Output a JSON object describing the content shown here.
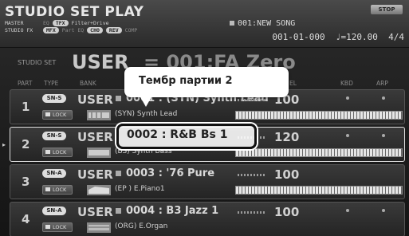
{
  "header": {
    "title": "STUDIO SET PLAY",
    "stop_label": "STOP",
    "row1_label": "MASTER",
    "row1_items": [
      "EQ",
      "TFX",
      "Filter+Drive"
    ],
    "row2_label": "STUDIO FX",
    "row2_items": [
      "MFX",
      "Part EQ",
      "CHO",
      "REV",
      "COMP"
    ],
    "song_label": "001:NEW SONG",
    "position": "001-01-000",
    "tempo": "♩=120.00",
    "time_sig": "4/4"
  },
  "studio_set": {
    "label": "STUDIO SET",
    "bank": "USER",
    "name": "= 001:FA Zero"
  },
  "columns": {
    "part": "PART",
    "type": "TYPE",
    "bank": "BANK",
    "level": "EL",
    "kbd": "KBD",
    "arp": "ARP"
  },
  "parts": [
    {
      "num": "1",
      "type": "SN-S",
      "lock": "LOCK",
      "bank": "USER",
      "tone": "0001 : (SYN) Synth Lead",
      "category": "(SYN) Synth Lead",
      "level": "100",
      "icon": "synth-icon"
    },
    {
      "num": "2",
      "type": "SN-S",
      "lock": "LOCK",
      "bank": "USER",
      "tone": "0002 : R&B Bs 1",
      "category": "(BS) Synth Bass",
      "level": "120",
      "icon": "bass-icon"
    },
    {
      "num": "3",
      "type": "SN-A",
      "lock": "LOCK",
      "bank": "USER",
      "tone": "0003 : '76 Pure",
      "category": "(EP ) E.Piano1",
      "level": "100",
      "icon": "piano-icon"
    },
    {
      "num": "4",
      "type": "SN-A",
      "lock": "LOCK",
      "bank": "USER",
      "tone": "0004 : B3 Jazz 1",
      "category": "(ORG) E.Organ",
      "level": "100",
      "icon": "organ-icon"
    }
  ],
  "callout": {
    "text": "Тембр партии 2",
    "highlight": "0002 : R&B Bs 1"
  }
}
